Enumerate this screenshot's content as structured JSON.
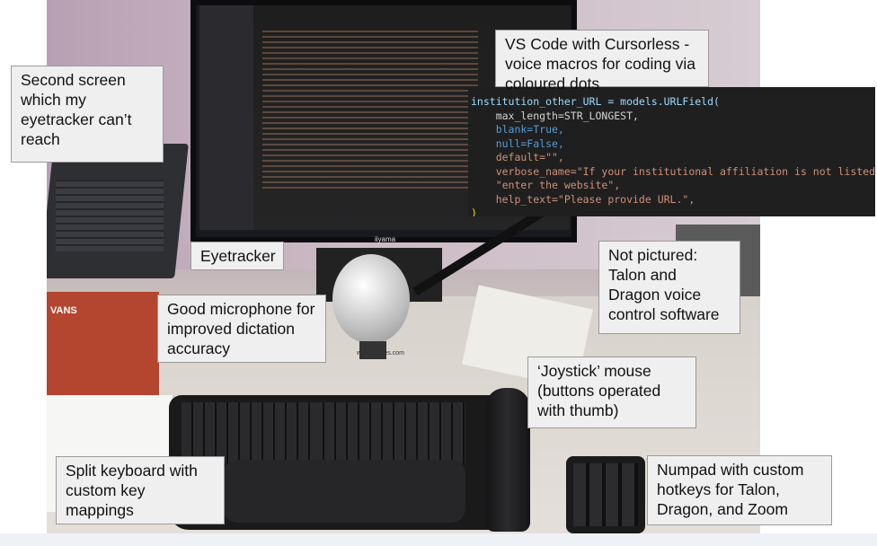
{
  "labels": {
    "second_screen": "Second screen which my eyetracker can’t reach",
    "vscode": "VS Code with Cursorless - voice macros for coding via coloured dots",
    "eyetracker": "Eyetracker",
    "microphone": "Good microphone for improved dictation accuracy",
    "not_pictured": "Not pictured: Talon and Dragon voice control software",
    "joystick": "‘Joystick’ mouse (buttons operated with thumb)",
    "keyboard": "Split keyboard with custom key mappings",
    "numpad": "Numpad with custom hotkeys for Talon, Dragon, and Zoom"
  },
  "code": {
    "line1": "institution_other_URL = models.URLField(",
    "line2": "    max_length=STR_LONGEST,",
    "line3": "    blank=True,",
    "line4": "    null=False,",
    "line5": "    default=\"\",",
    "line6": "    verbose_name=\"If your institutional affiliation is not listed, please \"",
    "line7": "    \"enter the website\",",
    "line8": "    help_text=\"Please provide URL.\",",
    "line9": ")"
  },
  "photo_text": {
    "monitor_brand": "iiyama",
    "box_brand": "VANS",
    "mic_sticker": "www.[...]nes.com"
  },
  "colors": {
    "label_bg": "#efefef",
    "label_border": "#9a9a9a",
    "code_bg": "#1f1f1f"
  }
}
